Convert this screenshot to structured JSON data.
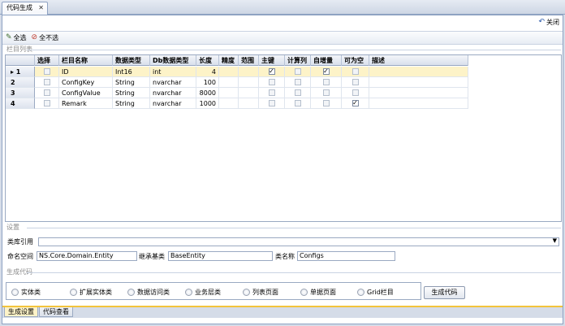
{
  "document_tab": {
    "title": "代码生成",
    "close_glyph": "✕"
  },
  "topbar": {
    "close_label": "关闭"
  },
  "toolbar": {
    "select_all": "全选",
    "select_none": "全不选"
  },
  "columns_section": {
    "title": "栏目列表"
  },
  "grid": {
    "headers": [
      "",
      "选择",
      "栏目名称",
      "数据类型",
      "Db数据类型",
      "长度",
      "精度",
      "范围",
      "主键",
      "计算列",
      "自增量",
      "可为空",
      "描述"
    ],
    "rows": [
      {
        "index": "1",
        "name": "ID",
        "type": "Int16",
        "db_type": "int",
        "length": "4",
        "precision": "",
        "range": "",
        "selected": false,
        "primary_key": true,
        "computed": false,
        "identity": true,
        "nullable": false,
        "description": "",
        "current": true
      },
      {
        "index": "2",
        "name": "ConfigKey",
        "type": "String",
        "db_type": "nvarchar",
        "length": "100",
        "precision": "",
        "range": "",
        "selected": false,
        "primary_key": false,
        "computed": false,
        "identity": false,
        "nullable": false,
        "description": "",
        "current": false
      },
      {
        "index": "3",
        "name": "ConfigValue",
        "type": "String",
        "db_type": "nvarchar",
        "length": "8000",
        "precision": "",
        "range": "",
        "selected": false,
        "primary_key": false,
        "computed": false,
        "identity": false,
        "nullable": false,
        "description": "",
        "current": false
      },
      {
        "index": "4",
        "name": "Remark",
        "type": "String",
        "db_type": "nvarchar",
        "length": "1000",
        "precision": "",
        "range": "",
        "selected": false,
        "primary_key": false,
        "computed": false,
        "identity": false,
        "nullable": true,
        "description": "",
        "current": false
      }
    ]
  },
  "settings": {
    "title": "设置",
    "library_ref_label": "类库引用",
    "library_ref_value": "",
    "namespace_label": "命名空间",
    "namespace_value": "NS.Core.Domain.Entity",
    "base_class_label": "继承基类",
    "base_class_value": "BaseEntity",
    "class_name_label": "类名称",
    "class_name_value": "Configs"
  },
  "generate": {
    "title": "生成代码",
    "options": [
      "实体类",
      "扩展实体类",
      "数据访问类",
      "业务层类",
      "列表页面",
      "单据页面",
      "Grid栏目"
    ],
    "button": "生成代码"
  },
  "bottom_tabs": [
    "生成设置",
    "代码查看"
  ],
  "colors": {
    "accent_tab": "#f3c43c",
    "selected_row": "#fdf3c8",
    "frame_border": "#8ea2c2"
  }
}
